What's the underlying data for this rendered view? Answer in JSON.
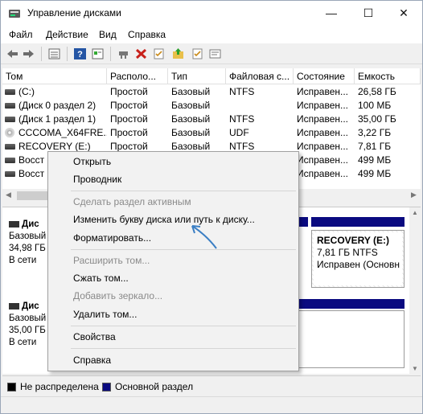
{
  "window": {
    "title": "Управление дисками",
    "controls": {
      "minimize": "—",
      "maximize": "☐",
      "close": "✕"
    }
  },
  "menu": [
    "Файл",
    "Действие",
    "Вид",
    "Справка"
  ],
  "toolbar_icons": [
    "back-arrow-icon",
    "forward-arrow-icon",
    "list-view-icon",
    "help-icon",
    "properties-icon",
    "connect-icon",
    "delete-icon",
    "checklist-icon",
    "folder-up-icon",
    "details-icon"
  ],
  "volumes": {
    "headers": [
      "Том",
      "Располо...",
      "Тип",
      "Файловая с...",
      "Состояние",
      "Емкость"
    ],
    "rows": [
      {
        "icon": "volume-icon",
        "name": "(C:)",
        "layout": "Простой",
        "type": "Базовый",
        "fs": "NTFS",
        "status": "Исправен...",
        "capacity": "26,58 ГБ"
      },
      {
        "icon": "volume-icon",
        "name": "(Диск 0 раздел 2)",
        "layout": "Простой",
        "type": "Базовый",
        "fs": "",
        "status": "Исправен...",
        "capacity": "100 МБ"
      },
      {
        "icon": "volume-icon",
        "name": "(Диск 1 раздел 1)",
        "layout": "Простой",
        "type": "Базовый",
        "fs": "NTFS",
        "status": "Исправен...",
        "capacity": "35,00 ГБ"
      },
      {
        "icon": "cd-icon",
        "name": "CCCOMA_X64FRE...",
        "layout": "Простой",
        "type": "Базовый",
        "fs": "UDF",
        "status": "Исправен...",
        "capacity": "3,22 ГБ"
      },
      {
        "icon": "volume-icon",
        "name": "RECOVERY (E:)",
        "layout": "Простой",
        "type": "Базовый",
        "fs": "NTFS",
        "status": "Исправен...",
        "capacity": "7,81 ГБ"
      },
      {
        "icon": "volume-icon",
        "name": "Восст",
        "layout": "",
        "type": "",
        "fs": "",
        "status": "Исправен...",
        "capacity": "499 МБ"
      },
      {
        "icon": "volume-icon",
        "name": "Восст",
        "layout": "",
        "type": "",
        "fs": "",
        "status": "Исправен...",
        "capacity": "499 МБ"
      }
    ]
  },
  "disks": [
    {
      "title": "Дис",
      "type": "Базовый",
      "size": "34,98 ГБ",
      "state": "В сети"
    },
    {
      "title": "Дис",
      "type": "Базовый",
      "size": "35,00 ГБ",
      "state": "В сети"
    }
  ],
  "recovery_partition": {
    "title": "RECOVERY  (E:)",
    "size_fs": "7,81 ГБ NTFS",
    "state": "Исправен (Основн"
  },
  "legend": [
    {
      "label": "Не распределена",
      "color": "#000000"
    },
    {
      "label": "Основной раздел",
      "color": "#0a0a80"
    }
  ],
  "context_menu": {
    "items": [
      {
        "label": "Открыть",
        "enabled": true
      },
      {
        "label": "Проводник",
        "enabled": true
      },
      {
        "label": "Сделать раздел активным",
        "enabled": false
      },
      {
        "label": "Изменить букву диска или путь к диску...",
        "enabled": true
      },
      {
        "label": "Форматировать...",
        "enabled": true
      },
      {
        "label": "Расширить том...",
        "enabled": false
      },
      {
        "label": "Сжать том...",
        "enabled": true
      },
      {
        "label": "Добавить зеркало...",
        "enabled": false
      },
      {
        "label": "Удалить том...",
        "enabled": true
      },
      {
        "label": "Свойства",
        "enabled": true
      },
      {
        "label": "Справка",
        "enabled": true
      }
    ]
  },
  "colors": {
    "primary_partition": "#0a0a80",
    "annotation_arrow": "#3b7fc4"
  }
}
